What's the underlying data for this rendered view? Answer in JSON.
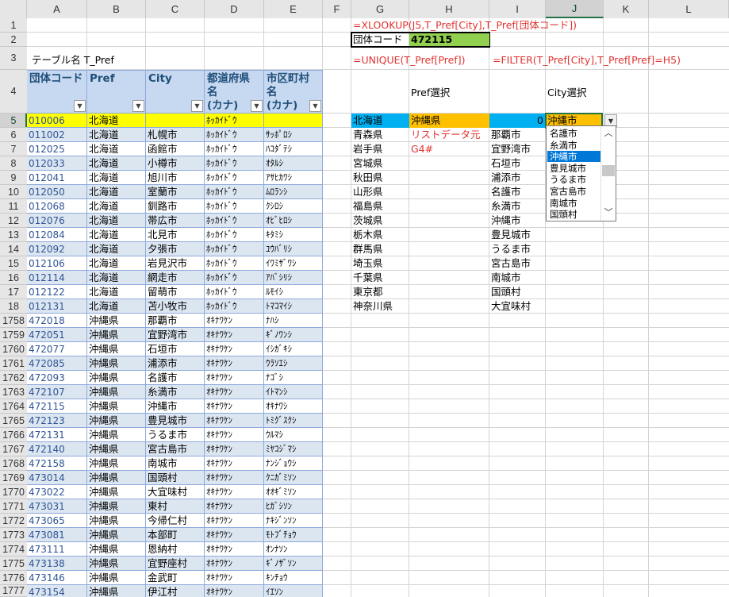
{
  "columns": [
    "A",
    "B",
    "C",
    "D",
    "E",
    "F",
    "G",
    "H",
    "I",
    "J",
    "K",
    "L"
  ],
  "selected_column": "J",
  "rows": [
    "1",
    "2",
    "3",
    "4",
    "5",
    "6",
    "7",
    "8",
    "9",
    "10",
    "11",
    "12",
    "13",
    "14",
    "15",
    "16",
    "17",
    "18",
    "1758",
    "1759",
    "1760",
    "1761",
    "1762",
    "1763",
    "1764",
    "1765",
    "1766",
    "1767",
    "1768",
    "1769",
    "1770",
    "1771",
    "1772",
    "1773",
    "1774",
    "1775",
    "1776",
    "1777"
  ],
  "selected_row": "5",
  "table_label": "テーブル名 T_Pref",
  "table_headers": [
    "団体コード",
    "Pref",
    "City",
    "都道府県\n名\n(カナ)",
    "市区町村\n名\n(カナ)"
  ],
  "filter_glyph": "▼",
  "table_rows": [
    [
      "010006",
      "北海道",
      "",
      "ﾎｯｶｲﾄﾞｳ",
      ""
    ],
    [
      "011002",
      "北海道",
      "札幌市",
      "ﾎｯｶｲﾄﾞｳ",
      "ｻｯﾎﾟﾛｼ"
    ],
    [
      "012025",
      "北海道",
      "函館市",
      "ﾎｯｶｲﾄﾞｳ",
      "ﾊｺﾀﾞﾃｼ"
    ],
    [
      "012033",
      "北海道",
      "小樽市",
      "ﾎｯｶｲﾄﾞｳ",
      "ｵﾀﾙｼ"
    ],
    [
      "012041",
      "北海道",
      "旭川市",
      "ﾎｯｶｲﾄﾞｳ",
      "ｱｻﾋｶﾜｼ"
    ],
    [
      "012050",
      "北海道",
      "室蘭市",
      "ﾎｯｶｲﾄﾞｳ",
      "ﾑﾛﾗﾝｼ"
    ],
    [
      "012068",
      "北海道",
      "釧路市",
      "ﾎｯｶｲﾄﾞｳ",
      "ｸｼﾛｼ"
    ],
    [
      "012076",
      "北海道",
      "帯広市",
      "ﾎｯｶｲﾄﾞｳ",
      "ｵﾋﾞﾋﾛｼ"
    ],
    [
      "012084",
      "北海道",
      "北見市",
      "ﾎｯｶｲﾄﾞｳ",
      "ｷﾀﾐｼ"
    ],
    [
      "012092",
      "北海道",
      "夕張市",
      "ﾎｯｶｲﾄﾞｳ",
      "ﾕｳﾊﾞﾘｼ"
    ],
    [
      "012106",
      "北海道",
      "岩見沢市",
      "ﾎｯｶｲﾄﾞｳ",
      "ｲﾜﾐｻﾞﾜｼ"
    ],
    [
      "012114",
      "北海道",
      "網走市",
      "ﾎｯｶｲﾄﾞｳ",
      "ｱﾊﾞｼﾘｼ"
    ],
    [
      "012122",
      "北海道",
      "留萌市",
      "ﾎｯｶｲﾄﾞｳ",
      "ﾙﾓｲｼ"
    ],
    [
      "012131",
      "北海道",
      "苫小牧市",
      "ﾎｯｶｲﾄﾞｳ",
      "ﾄﾏｺﾏｲｼ"
    ],
    [
      "472018",
      "沖縄県",
      "那覇市",
      "ｵｷﾅﾜｹﾝ",
      "ﾅﾊｼ"
    ],
    [
      "472051",
      "沖縄県",
      "宜野湾市",
      "ｵｷﾅﾜｹﾝ",
      "ｷﾞﾉﾜﾝｼ"
    ],
    [
      "472077",
      "沖縄県",
      "石垣市",
      "ｵｷﾅﾜｹﾝ",
      "ｲｼｶﾞｷｼ"
    ],
    [
      "472085",
      "沖縄県",
      "浦添市",
      "ｵｷﾅﾜｹﾝ",
      "ｳﾗｿｴｼ"
    ],
    [
      "472093",
      "沖縄県",
      "名護市",
      "ｵｷﾅﾜｹﾝ",
      "ﾅｺﾞｼ"
    ],
    [
      "472107",
      "沖縄県",
      "糸満市",
      "ｵｷﾅﾜｹﾝ",
      "ｲﾄﾏﾝｼ"
    ],
    [
      "472115",
      "沖縄県",
      "沖縄市",
      "ｵｷﾅﾜｹﾝ",
      "ｵｷﾅﾜｼ"
    ],
    [
      "472123",
      "沖縄県",
      "豊見城市",
      "ｵｷﾅﾜｹﾝ",
      "ﾄﾐｸﾞｽｸｼ"
    ],
    [
      "472131",
      "沖縄県",
      "うるま市",
      "ｵｷﾅﾜｹﾝ",
      "ｳﾙﾏｼ"
    ],
    [
      "472140",
      "沖縄県",
      "宮古島市",
      "ｵｷﾅﾜｹﾝ",
      "ﾐﾔｺｼﾞﾏｼ"
    ],
    [
      "472158",
      "沖縄県",
      "南城市",
      "ｵｷﾅﾜｹﾝ",
      "ﾅﾝｼﾞｮｳｼ"
    ],
    [
      "473014",
      "沖縄県",
      "国頭村",
      "ｵｷﾅﾜｹﾝ",
      "ｸﾆｶﾞﾐｿﾝ"
    ],
    [
      "473022",
      "沖縄県",
      "大宜味村",
      "ｵｷﾅﾜｹﾝ",
      "ｵｵｷﾞﾐｿﾝ"
    ],
    [
      "473031",
      "沖縄県",
      "東村",
      "ｵｷﾅﾜｹﾝ",
      "ﾋｶﾞｼｿﾝ"
    ],
    [
      "473065",
      "沖縄県",
      "今帰仁村",
      "ｵｷﾅﾜｹﾝ",
      "ﾅｷｼﾞﾝｿﾝ"
    ],
    [
      "473081",
      "沖縄県",
      "本部町",
      "ｵｷﾅﾜｹﾝ",
      "ﾓﾄﾌﾞﾁｮｳ"
    ],
    [
      "473111",
      "沖縄県",
      "恩納村",
      "ｵｷﾅﾜｹﾝ",
      "ｵﾝﾅｿﾝ"
    ],
    [
      "473138",
      "沖縄県",
      "宜野座村",
      "ｵｷﾅﾜｹﾝ",
      "ｷﾞﾉｻﾞｿﾝ"
    ],
    [
      "473146",
      "沖縄県",
      "金武町",
      "ｵｷﾅﾜｹﾝ",
      "ｷﾝﾁｮｳ"
    ],
    [
      "473154",
      "沖縄県",
      "伊江村",
      "ｵｷﾅﾜｹﾝ",
      "ｲｴｿﾝ"
    ]
  ],
  "formulas": {
    "g1": "=XLOOKUP(J5,T_Pref[City],T_Pref[団体コード])",
    "g3": "=UNIQUE(T_Pref[Pref])",
    "i3": "=FILTER(T_Pref[City],T_Pref[Pref]=H5)"
  },
  "code_label": "団体コード",
  "code_value": "472115",
  "pref_select_label": "Pref選択",
  "city_select_label": "City選択",
  "unique_list": [
    "北海道",
    "青森県",
    "岩手県",
    "宮城県",
    "秋田県",
    "山形県",
    "福島県",
    "茨城県",
    "栃木県",
    "群馬県",
    "埼玉県",
    "千葉県",
    "東京都",
    "神奈川県"
  ],
  "pref_selected": "沖縄県",
  "h6_note": "リストデータ元",
  "h7_note": "G4#",
  "filter_list": [
    "0",
    "那覇市",
    "宜野湾市",
    "石垣市",
    "浦添市",
    "名護市",
    "糸満市",
    "沖縄市",
    "豊見城市",
    "うるま市",
    "宮古島市",
    "南城市",
    "国頭村",
    "大宜味村"
  ],
  "city_selected": "沖縄市",
  "dropdown_items": [
    "名護市",
    "糸満市",
    "沖縄市",
    "豊見城市",
    "うるま市",
    "宮古島市",
    "南城市",
    "国頭村"
  ],
  "dropdown_highlighted_index": 2,
  "dropdown_button_glyph": "▼",
  "scroll_up_glyph": "︿",
  "scroll_down_glyph": "﹀",
  "colors": {
    "header_fill": "#c6d9f0",
    "band_fill": "#dce6f1",
    "row5_fill": "#ffff00",
    "code_fill": "#92d050",
    "pref_fill": "#ffc000",
    "g5_fill": "#00b0f0",
    "formula_red": "#e0332f",
    "selection_blue": "#0078d7"
  }
}
